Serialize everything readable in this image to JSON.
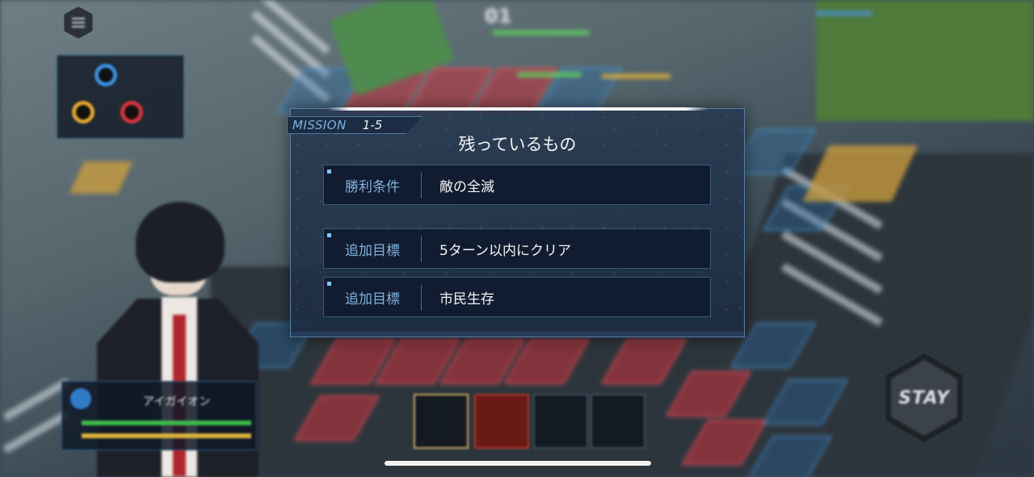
{
  "hud": {
    "menu_icon": "hamburger-menu-icon",
    "stay_label": "STAY",
    "unit_name": "アイガイオン",
    "turn_counter": "01"
  },
  "mission": {
    "tag_label": "MISSION",
    "tag_number": "1-5",
    "title": "残っているもの",
    "objectives": [
      {
        "category": "勝利条件",
        "value": "敵の全滅"
      },
      {
        "category": "追加目標",
        "value": "5ターン以内にクリア"
      },
      {
        "category": "追加目標",
        "value": "市民生存"
      }
    ]
  },
  "colors": {
    "accent": "#7fb1de",
    "dialog_bg": "#1c2c42",
    "row_bg": "#121c30",
    "tile_red": "#c8323c",
    "tile_blue": "#286eaa"
  }
}
